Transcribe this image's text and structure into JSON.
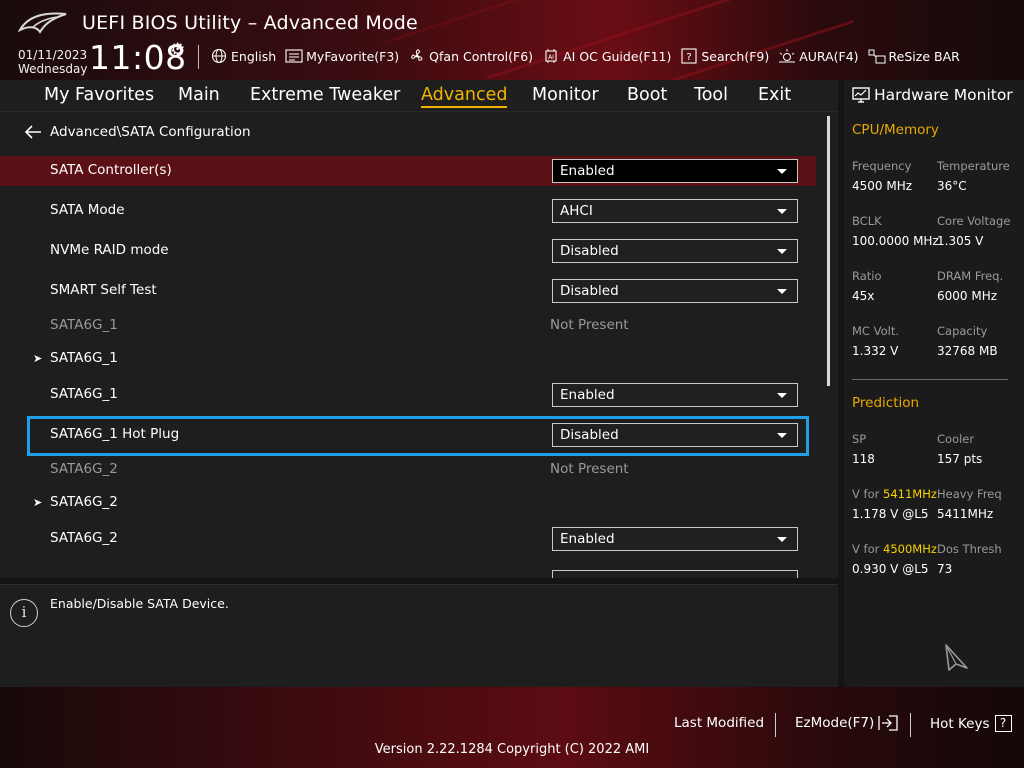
{
  "app": {
    "title": "UEFI BIOS Utility – Advanced Mode"
  },
  "datetime": {
    "date": "01/11/2023",
    "day": "Wednesday",
    "time": "11:08"
  },
  "toolbar": {
    "language": "English",
    "favorite": "MyFavorite(F3)",
    "qfan": "Qfan Control(F6)",
    "aioc": "AI OC Guide(F11)",
    "search": "Search(F9)",
    "aura": "AURA(F4)",
    "resizebar": "ReSize BAR"
  },
  "tabs": [
    "My Favorites",
    "Main",
    "Extreme Tweaker",
    "Advanced",
    "Monitor",
    "Boot",
    "Tool",
    "Exit"
  ],
  "active_tab": "Advanced",
  "breadcrumb": "Advanced\\SATA Configuration",
  "rows": [
    {
      "label": "SATA Controller(s)",
      "value": "Enabled"
    },
    {
      "label": "SATA Mode",
      "value": "AHCI"
    },
    {
      "label": "NVMe RAID mode",
      "value": "Disabled"
    },
    {
      "label": "SMART Self Test",
      "value": "Disabled"
    },
    {
      "label": "SATA6G_1",
      "status": "Not Present"
    },
    {
      "label": "SATA6G_1"
    },
    {
      "label": "SATA6G_1",
      "value": "Enabled"
    },
    {
      "label": "SATA6G_1 Hot Plug",
      "value": "Disabled"
    },
    {
      "label": "SATA6G_2",
      "status": "Not Present"
    },
    {
      "label": "SATA6G_2"
    },
    {
      "label": "SATA6G_2",
      "value": "Enabled"
    }
  ],
  "help_text": "Enable/Disable SATA Device.",
  "help_icon": "i",
  "hw": {
    "title": "Hardware Monitor",
    "cpu_section": "CPU/Memory",
    "freq_label": "Frequency",
    "freq": "4500 MHz",
    "temp_label": "Temperature",
    "temp": "36°C",
    "bclk_label": "BCLK",
    "bclk": "100.0000 MHz",
    "cv_label": "Core Voltage",
    "cv": "1.305 V",
    "ratio_label": "Ratio",
    "ratio": "45x",
    "dram_label": "DRAM Freq.",
    "dram": "6000 MHz",
    "mcv_label": "MC Volt.",
    "mcv": "1.332 V",
    "cap_label": "Capacity",
    "cap": "32768 MB",
    "pred_section": "Prediction",
    "sp_label": "SP",
    "sp": "118",
    "cooler_label": "Cooler",
    "cooler": "157 pts",
    "vfor_prefix": "V for ",
    "v1_freq": "5411MHz",
    "v1": "1.178 V @L5",
    "hf_label": "Heavy Freq",
    "hf": "5411MHz",
    "v2_freq": "4500MHz",
    "v2": "0.930 V @L5",
    "dt_label": "Dos Thresh",
    "dt": "73"
  },
  "footer": {
    "last_modified": "Last Modified",
    "ezmode": "EzMode(F7)",
    "hotkeys": "Hot Keys",
    "hotkeys_key": "?",
    "version": "Version 2.22.1284 Copyright (C) 2022 AMI"
  }
}
